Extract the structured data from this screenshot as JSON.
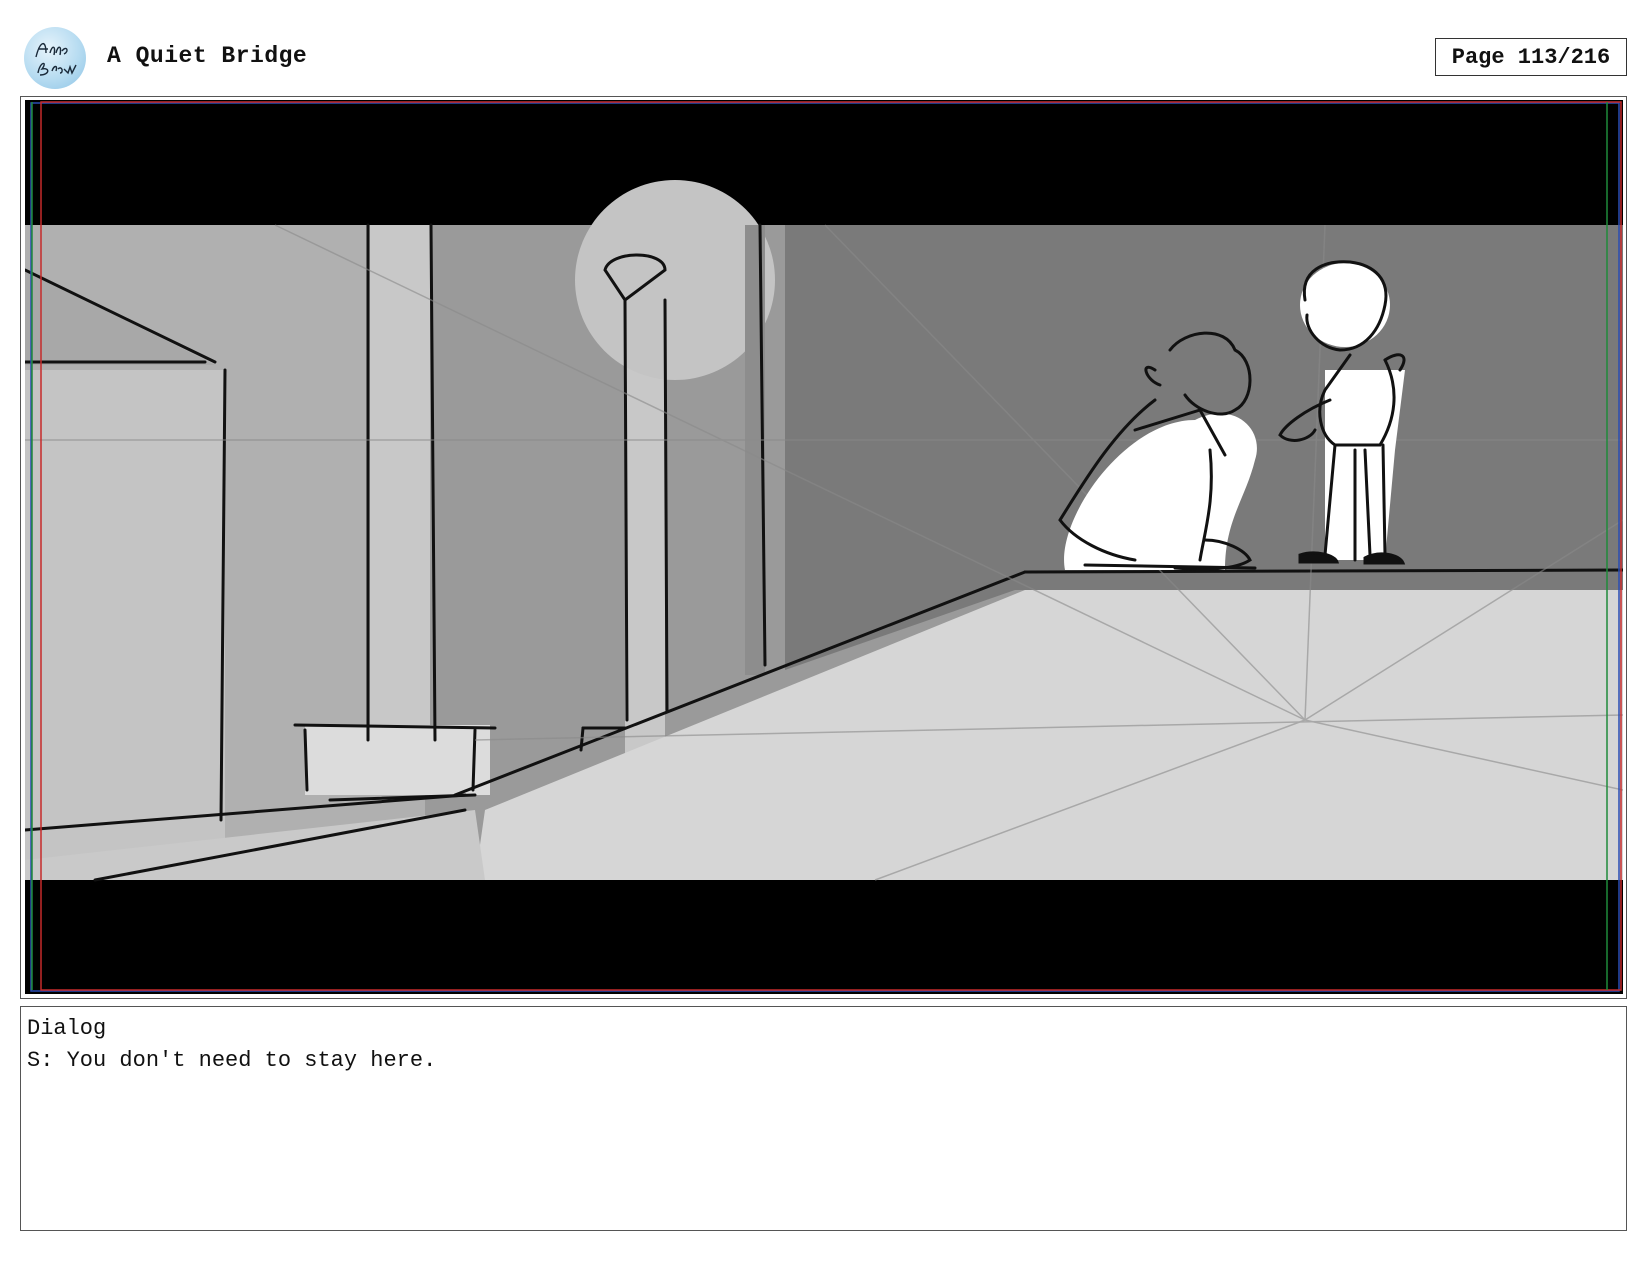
{
  "header": {
    "logo_text": "Anna Brown",
    "title": "A Quiet Bridge",
    "page_label": "Page 113/216"
  },
  "panel": {
    "description_icon": "storyboard-sketch-image"
  },
  "dialog": {
    "heading": "Dialog",
    "line": "S: You don't need to stay here."
  }
}
